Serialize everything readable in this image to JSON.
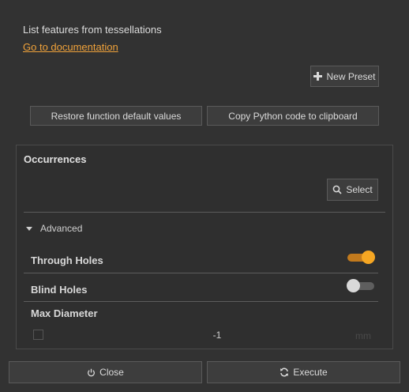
{
  "header": {
    "description": "List features from tessellations",
    "doc_link": "Go to documentation"
  },
  "toolbar": {
    "new_preset_label": "New Preset",
    "restore_label": "Restore function default values",
    "copy_label": "Copy Python code to clipboard"
  },
  "occurrences": {
    "title": "Occurrences",
    "select_label": "Select"
  },
  "advanced": {
    "label": "Advanced",
    "through_holes": {
      "label": "Through Holes",
      "enabled": true
    },
    "blind_holes": {
      "label": "Blind Holes",
      "enabled": false
    },
    "max_diameter": {
      "label": "Max Diameter",
      "checked": false,
      "value": "-1",
      "unit": "mm"
    }
  },
  "footer": {
    "close_label": "Close",
    "execute_label": "Execute"
  },
  "colors": {
    "accent": "#f5a623",
    "link": "#f0a23a",
    "background": "#323232"
  }
}
